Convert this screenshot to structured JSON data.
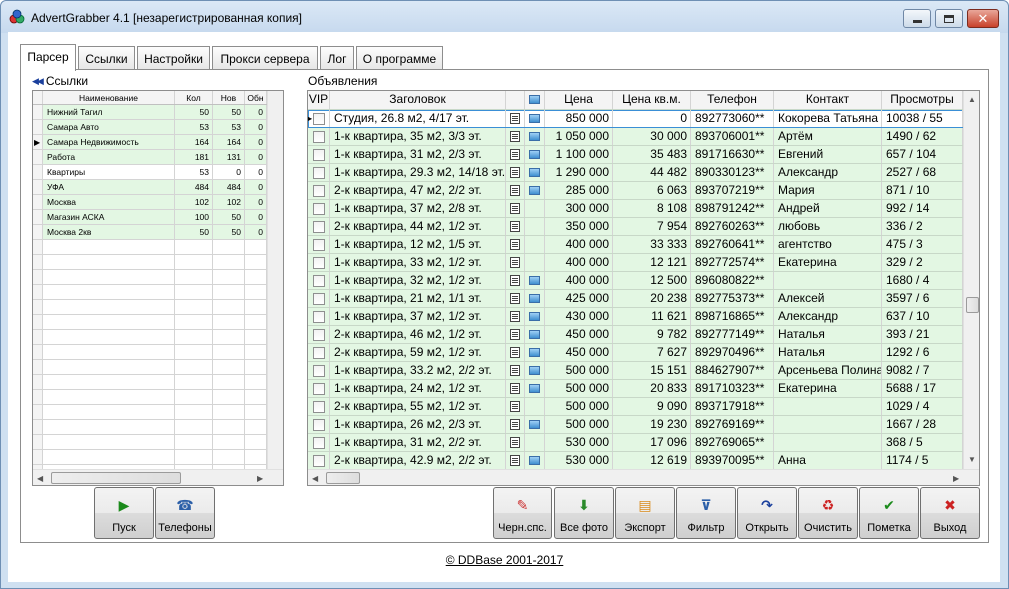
{
  "window": {
    "title": "AdvertGrabber 4.1 [незарегистрированная копия]"
  },
  "tabs": [
    {
      "label": "Парсер",
      "active": true
    },
    {
      "label": "Ссылки"
    },
    {
      "label": "Настройки"
    },
    {
      "label": "Прокси сервера"
    },
    {
      "label": "Лог"
    },
    {
      "label": "О программе"
    }
  ],
  "links": {
    "title": "Ссылки",
    "columns": [
      "Наименование",
      "Кол",
      "Нов",
      "Обн"
    ],
    "rows": [
      {
        "name": "Нижний Тагил",
        "count": "50",
        "new": "50",
        "upd": "0"
      },
      {
        "name": "Самара Авто",
        "count": "53",
        "new": "53",
        "upd": "0"
      },
      {
        "name": "Самара Недвижимость",
        "count": "164",
        "new": "164",
        "upd": "0"
      },
      {
        "name": "Работа",
        "count": "181",
        "new": "131",
        "upd": "0"
      },
      {
        "name": "Квартиры",
        "count": "53",
        "new": "0",
        "upd": "0"
      },
      {
        "name": "УФА",
        "count": "484",
        "new": "484",
        "upd": "0"
      },
      {
        "name": "Москва",
        "count": "102",
        "new": "102",
        "upd": "0"
      },
      {
        "name": "Магазин АСКА",
        "count": "100",
        "new": "50",
        "upd": "0"
      },
      {
        "name": "Москва 2кв",
        "count": "50",
        "new": "50",
        "upd": "0"
      }
    ]
  },
  "ads": {
    "title": "Объявления",
    "columns": [
      "VIP",
      "Заголовок",
      "",
      "",
      "Цена",
      "Цена кв.м.",
      "Телефон",
      "Контакт",
      "Просмотры"
    ],
    "rows": [
      {
        "title": "Студия, 26.8 м2, 4/17 эт.",
        "photo": true,
        "price": "850 000",
        "sqm": "0",
        "phone": "892773060**",
        "contact": "Кокорева Татьяна",
        "views": "10038 / 55"
      },
      {
        "title": "1-к квартира, 35 м2, 3/3 эт.",
        "photo": true,
        "price": "1 050 000",
        "sqm": "30 000",
        "phone": "893706001**",
        "contact": "Артём",
        "views": "1490 / 62"
      },
      {
        "title": "1-к квартира, 31 м2, 2/3 эт.",
        "photo": true,
        "price": "1 100 000",
        "sqm": "35 483",
        "phone": "891716630**",
        "contact": "Евгений",
        "views": "657 / 104"
      },
      {
        "title": "1-к квартира, 29.3 м2, 14/18 эт.",
        "photo": true,
        "price": "1 290 000",
        "sqm": "44 482",
        "phone": "890330123**",
        "contact": "Александр",
        "views": "2527 / 68"
      },
      {
        "title": "2-к квартира, 47 м2, 2/2 эт.",
        "photo": true,
        "price": "285 000",
        "sqm": "6 063",
        "phone": "893707219**",
        "contact": "Мария",
        "views": "871 / 10"
      },
      {
        "title": "1-к квартира, 37 м2, 2/8 эт.",
        "photo": false,
        "price": "300 000",
        "sqm": "8 108",
        "phone": "898791242**",
        "contact": "Андрей",
        "views": "992 / 14"
      },
      {
        "title": "2-к квартира, 44 м2, 1/2 эт.",
        "photo": false,
        "price": "350 000",
        "sqm": "7 954",
        "phone": "892760263**",
        "contact": "любовь",
        "views": "336 / 2"
      },
      {
        "title": "1-к квартира, 12 м2, 1/5 эт.",
        "photo": false,
        "price": "400 000",
        "sqm": "33 333",
        "phone": "892760641**",
        "contact": "агентство",
        "views": "475 / 3"
      },
      {
        "title": "1-к квартира, 33 м2, 1/2 эт.",
        "photo": false,
        "price": "400 000",
        "sqm": "12 121",
        "phone": "892772574**",
        "contact": "Екатерина",
        "views": "329 / 2"
      },
      {
        "title": "1-к квартира, 32 м2, 1/2 эт.",
        "photo": true,
        "price": "400 000",
        "sqm": "12 500",
        "phone": "896080822**",
        "contact": "",
        "views": "1680 / 4"
      },
      {
        "title": "1-к квартира, 21 м2, 1/1 эт.",
        "photo": true,
        "price": "425 000",
        "sqm": "20 238",
        "phone": "892775373**",
        "contact": "Алексей",
        "views": "3597 / 6"
      },
      {
        "title": "1-к квартира, 37 м2, 1/2 эт.",
        "photo": true,
        "price": "430 000",
        "sqm": "11 621",
        "phone": "898716865**",
        "contact": "Александр",
        "views": "637 / 10"
      },
      {
        "title": "2-к квартира, 46 м2, 1/2 эт.",
        "photo": true,
        "price": "450 000",
        "sqm": "9 782",
        "phone": "892777149**",
        "contact": "Наталья",
        "views": "393 / 21"
      },
      {
        "title": "2-к квартира, 59 м2, 1/2 эт.",
        "photo": true,
        "price": "450 000",
        "sqm": "7 627",
        "phone": "892970496**",
        "contact": "Наталья",
        "views": "1292 / 6"
      },
      {
        "title": "1-к квартира, 33.2 м2, 2/2 эт.",
        "photo": true,
        "price": "500 000",
        "sqm": "15 151",
        "phone": "884627907**",
        "contact": "Арсеньева Полина",
        "views": "9082 / 7"
      },
      {
        "title": "1-к квартира, 24 м2, 1/2 эт.",
        "photo": true,
        "price": "500 000",
        "sqm": "20 833",
        "phone": "891710323**",
        "contact": "Екатерина",
        "views": "5688 / 17"
      },
      {
        "title": "2-к квартира, 55 м2, 1/2 эт.",
        "photo": false,
        "price": "500 000",
        "sqm": "9 090",
        "phone": "893717918**",
        "contact": "",
        "views": "1029 / 4"
      },
      {
        "title": "1-к квартира, 26 м2, 2/3 эт.",
        "photo": true,
        "price": "500 000",
        "sqm": "19 230",
        "phone": "892769169**",
        "contact": "",
        "views": "1667 / 28"
      },
      {
        "title": "1-к квартира, 31 м2, 2/2 эт.",
        "photo": false,
        "price": "530 000",
        "sqm": "17 096",
        "phone": "892769065**",
        "contact": "",
        "views": "368 / 5"
      },
      {
        "title": "2-к квартира, 42.9 м2, 2/2 эт.",
        "photo": true,
        "price": "530 000",
        "sqm": "12 619",
        "phone": "893970095**",
        "contact": "Анна",
        "views": "1174 / 5"
      }
    ]
  },
  "left_buttons": [
    {
      "label": "Пуск",
      "icon": "play-icon"
    },
    {
      "label": "Телефоны",
      "icon": "phone-icon"
    }
  ],
  "right_buttons": [
    {
      "label": "Черн.спс.",
      "icon": "blacklist-icon"
    },
    {
      "label": "Все фото",
      "icon": "photos-icon"
    },
    {
      "label": "Экспорт",
      "icon": "export-icon"
    },
    {
      "label": "Фильтр",
      "icon": "filter-icon"
    },
    {
      "label": "Открыть",
      "icon": "open-icon"
    },
    {
      "label": "Очистить",
      "icon": "clear-icon"
    },
    {
      "label": "Пометка",
      "icon": "check-icon"
    },
    {
      "label": "Выход",
      "icon": "exit-icon"
    }
  ],
  "footer": {
    "text": "© DDBase 2001-2017"
  }
}
